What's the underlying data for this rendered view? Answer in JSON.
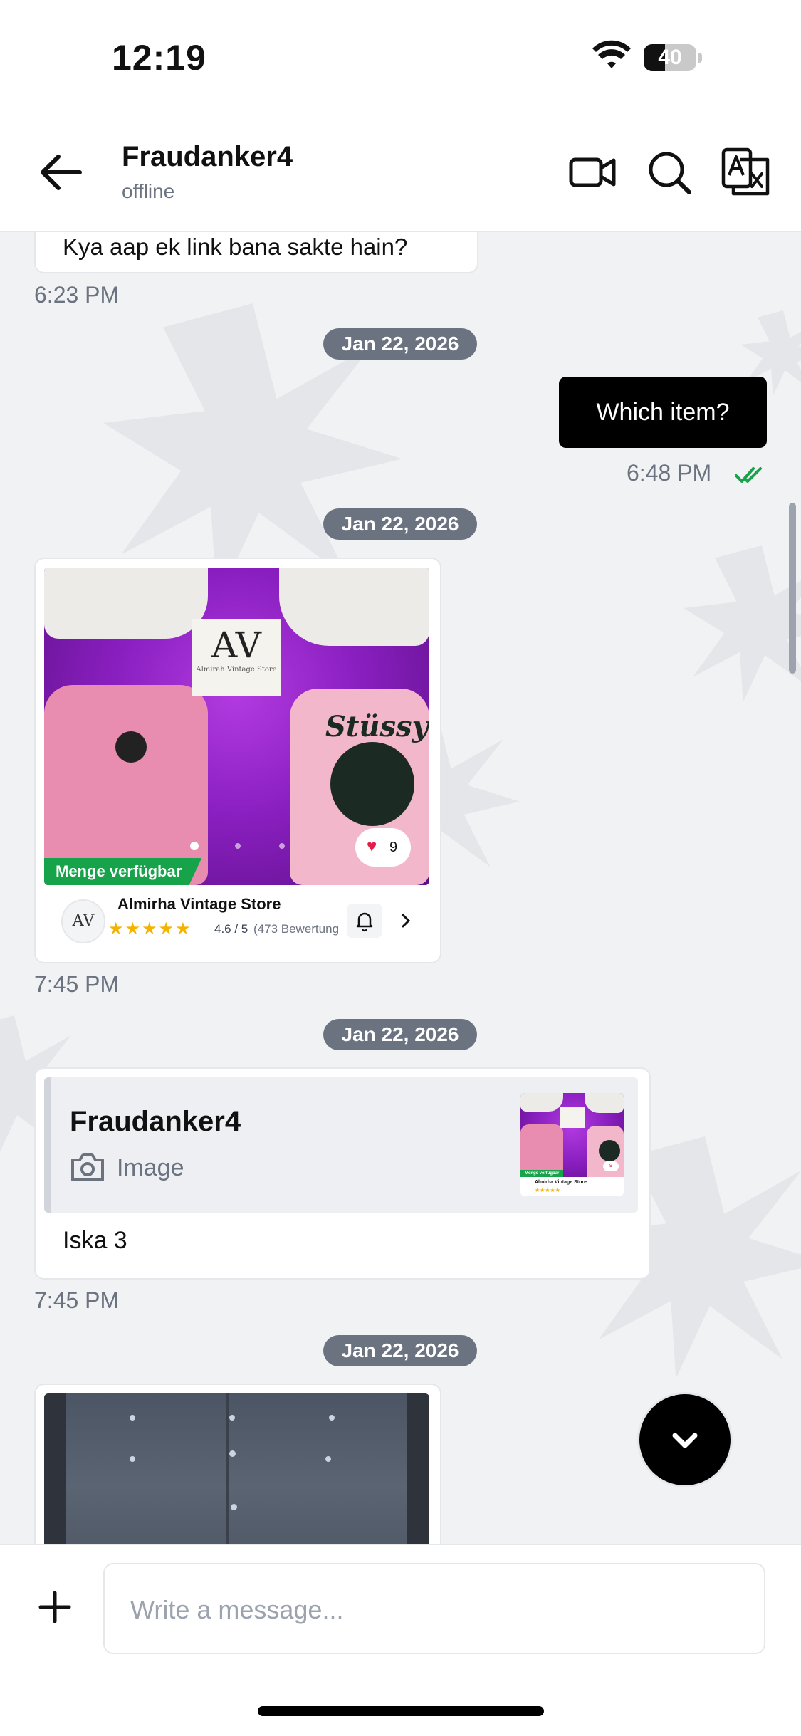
{
  "status": {
    "time": "12:19",
    "battery": "40"
  },
  "header": {
    "name": "Fraudanker4",
    "status": "offline"
  },
  "messages": {
    "m1_text": "Kya aap ek link bana sakte hain?",
    "m1_time": "6:23 PM",
    "date1": "Jan 22, 2026",
    "m2_text": "Which item?",
    "m2_time": "6:48 PM",
    "date2": "Jan 22, 2026",
    "m3_time": "7:45 PM",
    "date3": "Jan 22, 2026",
    "m4_quote_name": "Fraudanker4",
    "m4_quote_type": "Image",
    "m4_text": "Iska 3",
    "m4_time": "7:45 PM",
    "date4": "Jan 22, 2026"
  },
  "product": {
    "logo_text": "AV",
    "logo_sub": "Almirah Vintage Store",
    "sweater_print": "Stüssy",
    "availability": "Menge verfügbar",
    "likes": "9",
    "store_name": "Almirha Vintage Store",
    "rating": "4.6 / 5",
    "reviews": "(473 Bewertung",
    "rating_value": 4.6
  },
  "thumb": {
    "availability": "Menge verfügbar",
    "store_name": "Almirha Vintage Store",
    "likes": "9"
  },
  "input": {
    "placeholder": "Write a message..."
  },
  "colors": {
    "green": "#16a34a",
    "tick": "#16a34a",
    "pill": "#6b7280",
    "purple": "#8b1fb8",
    "pink": "#e98db0"
  }
}
